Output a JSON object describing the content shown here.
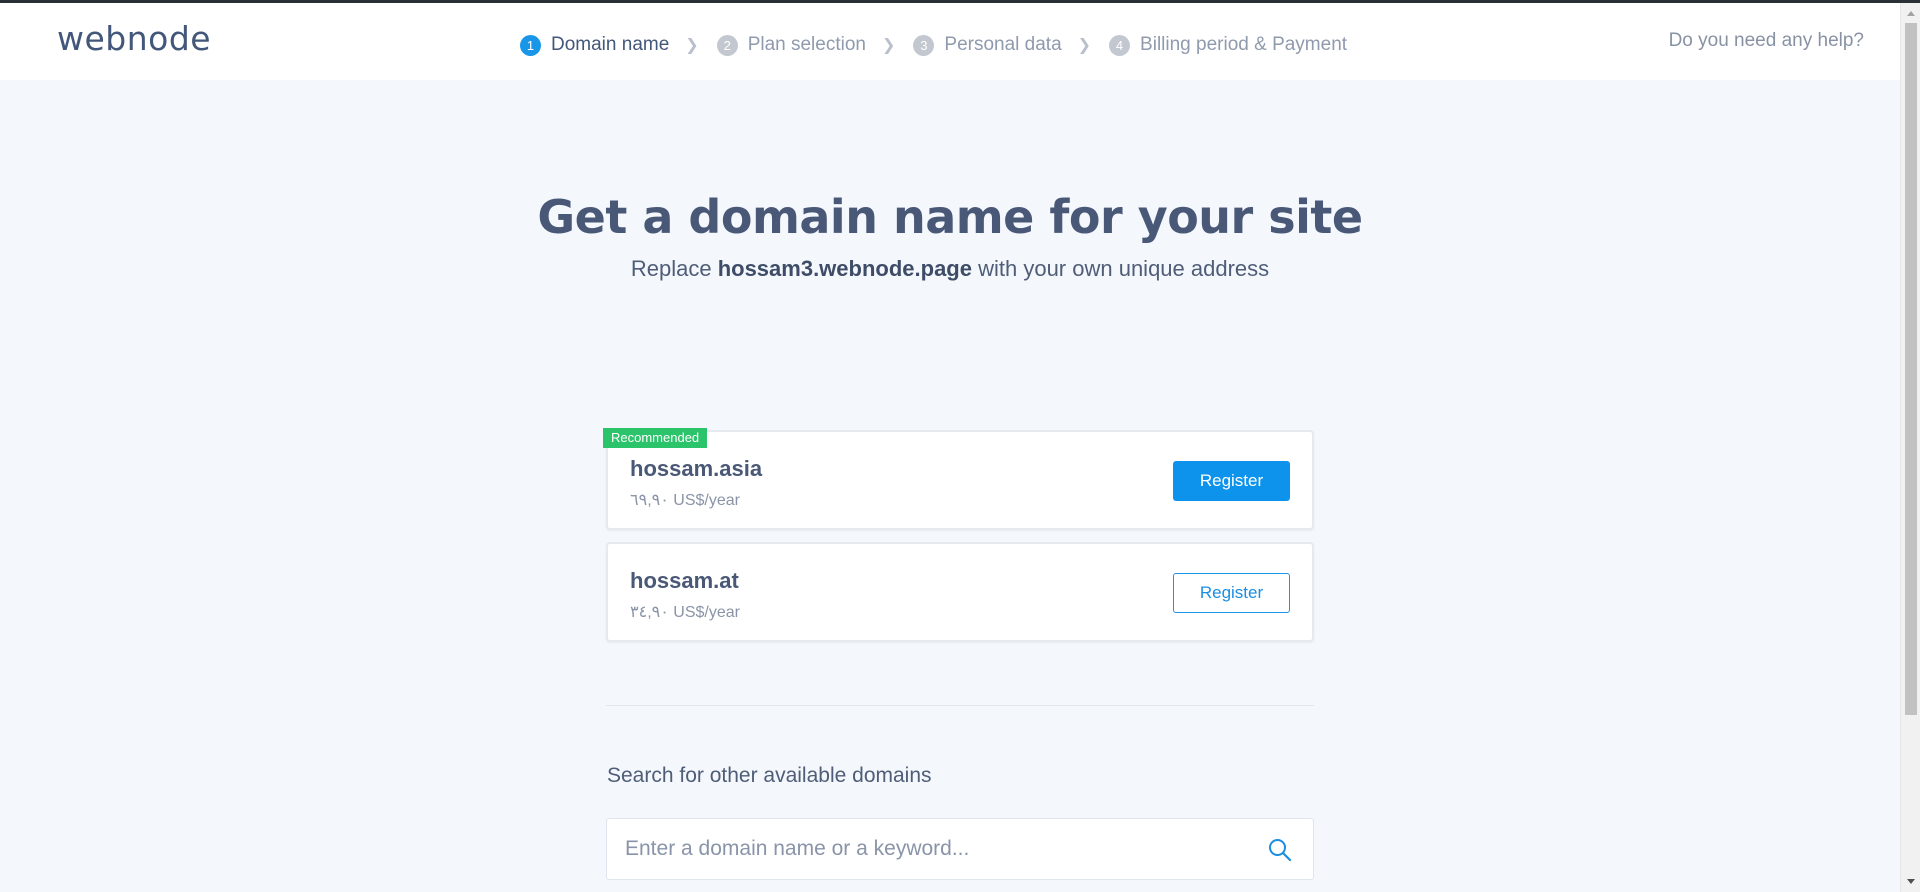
{
  "brand": {
    "logo_text": "webnode"
  },
  "steps": [
    {
      "num": "1",
      "label": "Domain name",
      "active": true
    },
    {
      "num": "2",
      "label": "Plan selection",
      "active": false
    },
    {
      "num": "3",
      "label": "Personal data",
      "active": false
    },
    {
      "num": "4",
      "label": "Billing period & Payment",
      "active": false
    }
  ],
  "header": {
    "help_link": "Do you need any help?"
  },
  "hero": {
    "title": "Get a domain name for your site",
    "subtitle_prefix": "Replace ",
    "current_address": "hossam3.webnode.page",
    "subtitle_suffix": " with your own unique address"
  },
  "domains": [
    {
      "badge": "Recommended",
      "name": "hossam.asia",
      "price": "٦٩,٩٠ US$/year",
      "button": "Register",
      "style": "primary"
    },
    {
      "badge": "",
      "name": "hossam.at",
      "price": "٣٤,٩٠ US$/year",
      "button": "Register",
      "style": "outline"
    }
  ],
  "search": {
    "label": "Search for other available domains",
    "placeholder": "Enter a domain name or a keyword...",
    "value": ""
  },
  "colors": {
    "accent": "#0e93ec",
    "recommended_badge": "#2cc46b",
    "page_background": "#f4f8fc"
  }
}
